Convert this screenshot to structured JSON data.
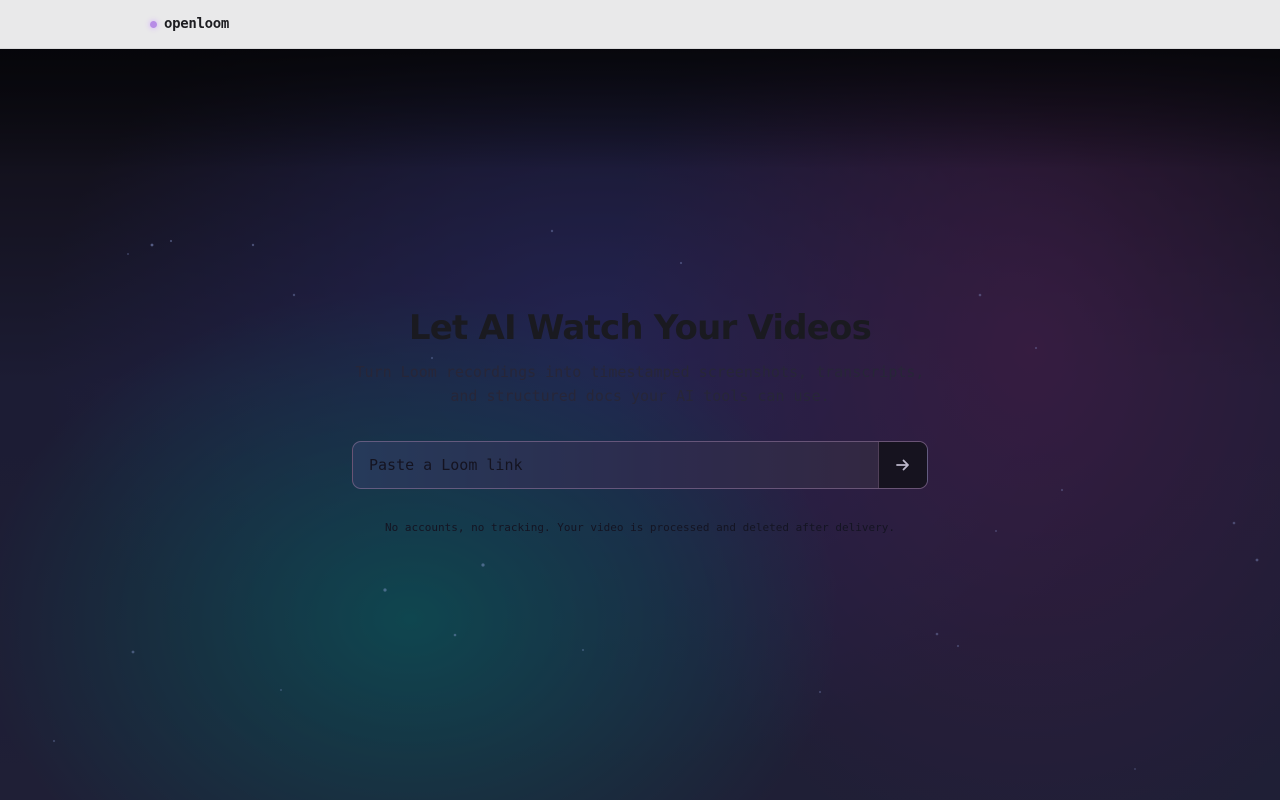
{
  "header": {
    "brand_name": "openloom",
    "brand_dot_color": "#b78ce6"
  },
  "hero": {
    "headline": "Let AI Watch Your Videos",
    "subtitle": "Turn Loom recordings into timestamped screenshots, transcripts, and structured docs your AI tools can use.",
    "input_placeholder": "Paste a Loom link",
    "input_value": "",
    "submit_icon": "arrow-right-icon",
    "note": "No accounts, no tracking. Your video is processed and deleted after delivery."
  },
  "colors": {
    "topbar_bg": "#e9e9ea",
    "hero_teal": "#0e4850",
    "hero_indigo": "#242454",
    "hero_plum": "#3a1c42",
    "button_bg": "#16131f"
  }
}
